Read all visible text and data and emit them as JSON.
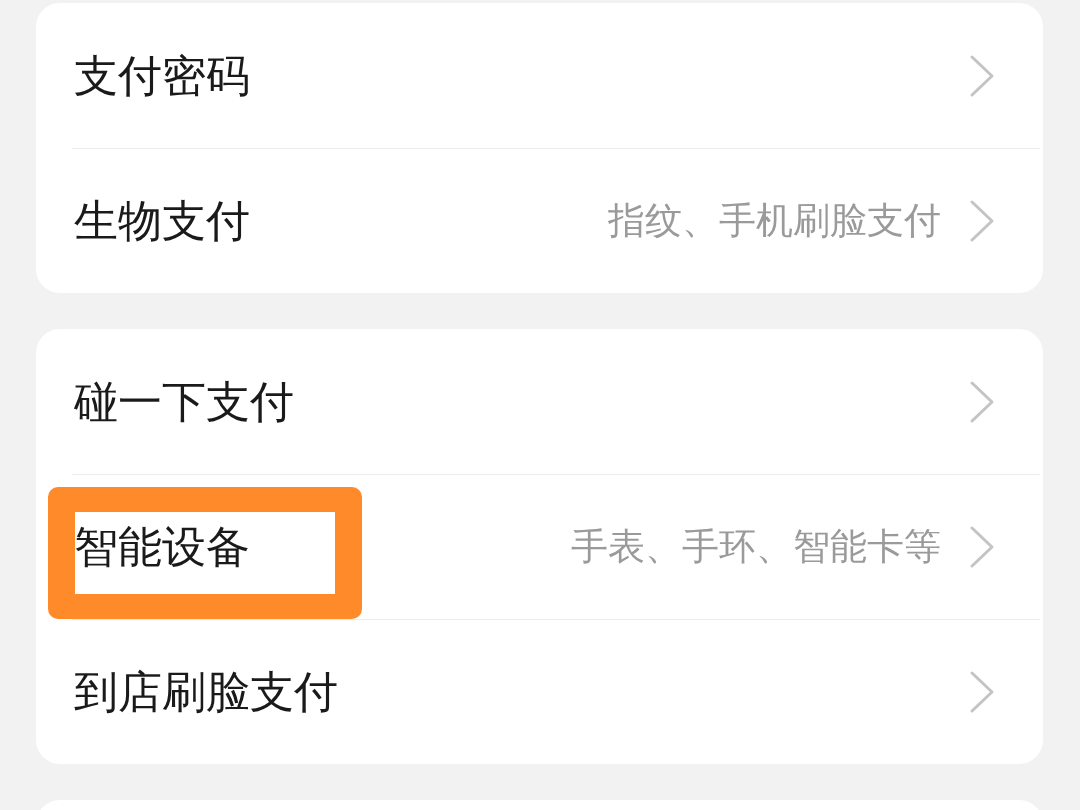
{
  "groups": [
    {
      "items": [
        {
          "label": "支付密码",
          "highlighted": false
        },
        {
          "label": "生物支付",
          "value": "指纹、手机刷脸支付",
          "highlighted": false
        }
      ]
    },
    {
      "items": [
        {
          "label": "碰一下支付",
          "highlighted": false
        },
        {
          "label": "智能设备",
          "value": "手表、手环、智能卡等",
          "highlighted": true
        },
        {
          "label": "到店刷脸支付",
          "highlighted": false
        }
      ]
    },
    {
      "kind": "empty"
    }
  ]
}
